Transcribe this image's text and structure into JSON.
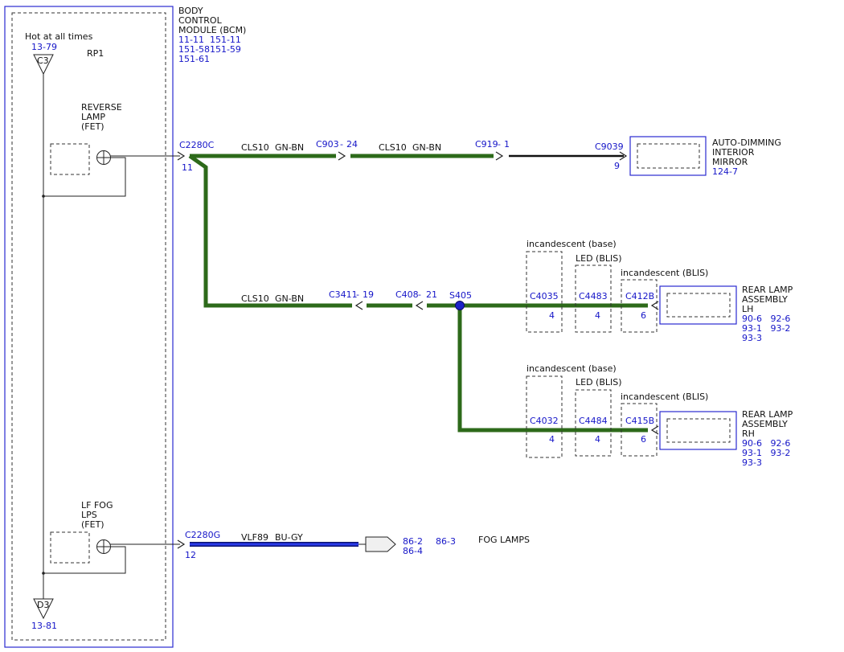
{
  "colors": {
    "module_border": "#2a2ad0",
    "wire_green": "#2d6a1a",
    "wire_blue": "#1b22c8",
    "ref_text": "#1515c8",
    "component_fill": "#f0f0f0"
  },
  "bcm": {
    "title_lines": [
      "BODY",
      "CONTROL",
      "MODULE (BCM)"
    ],
    "ref_lines": [
      "11-11  151-11",
      "151-58151-59",
      "151-61"
    ],
    "hot_label": "Hot at all times",
    "hot_ref": "13-79",
    "top_terminal": "C3",
    "rp_label": "RP1",
    "bottom_terminal": "D3",
    "bottom_ref": "13-81",
    "reverse_fet_lines": [
      "REVERSE",
      "LAMP",
      "(FET)"
    ],
    "fog_fet_lines": [
      "LF FOG",
      "LPS",
      "(FET)"
    ]
  },
  "connectors": {
    "c2280c": {
      "name": "C2280C",
      "pin": "11"
    },
    "c2280g": {
      "name": "C2280G",
      "pin": "12"
    },
    "c903": {
      "name": "C903",
      "pin": "24"
    },
    "c919": {
      "name": "C919",
      "pin": "1"
    },
    "c9039": {
      "name": "C9039",
      "pin": "9"
    },
    "c3411": {
      "name": "C3411",
      "pin": "19"
    },
    "c408": {
      "name": "C408",
      "pin": "21"
    },
    "splice": "S405"
  },
  "wires": {
    "green": {
      "circuit": "CLS10",
      "color": "GN-BN"
    },
    "blue": {
      "circuit": "VLF89",
      "color": "BU-GY"
    }
  },
  "mirror": {
    "lines": [
      "AUTO-DIMMING",
      "INTERIOR",
      "MIRROR"
    ],
    "ref": "124-7"
  },
  "lamp_variants": {
    "incandescent_base": "incandescent (base)",
    "led_blis": "LED (BLIS)",
    "incandescent_blis": "incandescent (BLIS)"
  },
  "rear_lh": {
    "lines": [
      "REAR LAMP",
      "ASSEMBLY",
      "LH"
    ],
    "refs": [
      "90-6   92-6",
      "93-1   93-2",
      "93-3"
    ],
    "connectors": [
      {
        "name": "C4035",
        "pin": "4"
      },
      {
        "name": "C4483",
        "pin": "4"
      },
      {
        "name": "C412B",
        "pin": "6"
      }
    ]
  },
  "rear_rh": {
    "lines": [
      "REAR LAMP",
      "ASSEMBLY",
      "RH"
    ],
    "refs": [
      "90-6   92-6",
      "93-1   93-2",
      "93-3"
    ],
    "connectors": [
      {
        "name": "C4032",
        "pin": "4"
      },
      {
        "name": "C4484",
        "pin": "4"
      },
      {
        "name": "C415B",
        "pin": "6"
      }
    ]
  },
  "fog": {
    "refs_a": "86-2",
    "refs_b": "86-3",
    "refs_c": "86-4",
    "label": "FOG LAMPS"
  }
}
